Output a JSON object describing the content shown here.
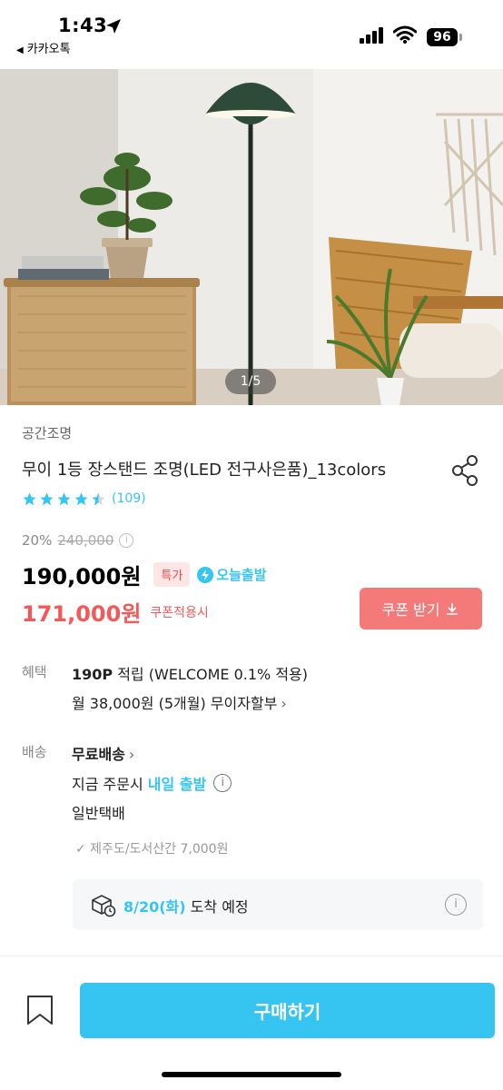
{
  "status_bar": {
    "time": "1:43",
    "back_app": "카카오톡",
    "battery": "96"
  },
  "gallery": {
    "counter": "1/5"
  },
  "product": {
    "brand": "공간조명",
    "title": "무이 1등 장스탠드 조명(LED 전구사은품)_13colors",
    "rating": 4.5,
    "review_count": "(109)",
    "discount": "20%",
    "original_price": "240,000",
    "info_glyph": "i",
    "price": "190,000원",
    "badge_special": "특가",
    "today_ship": "오늘출발",
    "coupon_price": "171,000원",
    "coupon_note": "쿠폰적용시",
    "coupon_button": "쿠폰 받기"
  },
  "benefit": {
    "label": "혜택",
    "points": "190P",
    "points_rest": " 적립 (WELCOME 0.1% 적용)",
    "installment": "월 38,000원 (5개월) 무이자할부"
  },
  "shipping": {
    "label": "배송",
    "free": "무료배송",
    "order_prefix": "지금 주문시 ",
    "order_highlight": "내일 출발",
    "method": "일반택배",
    "extra_fee": "✓ 제주도/도서산간 7,000원",
    "arrival_date": "8/20(화)",
    "arrival_rest": " 도착 예정"
  },
  "footer": {
    "buy_button": "구매하기"
  },
  "colors": {
    "accent_blue": "#35c5f0",
    "coupon_red": "#f25a5a",
    "coupon_button": "#f47a7a",
    "star": "#35c5f0"
  }
}
